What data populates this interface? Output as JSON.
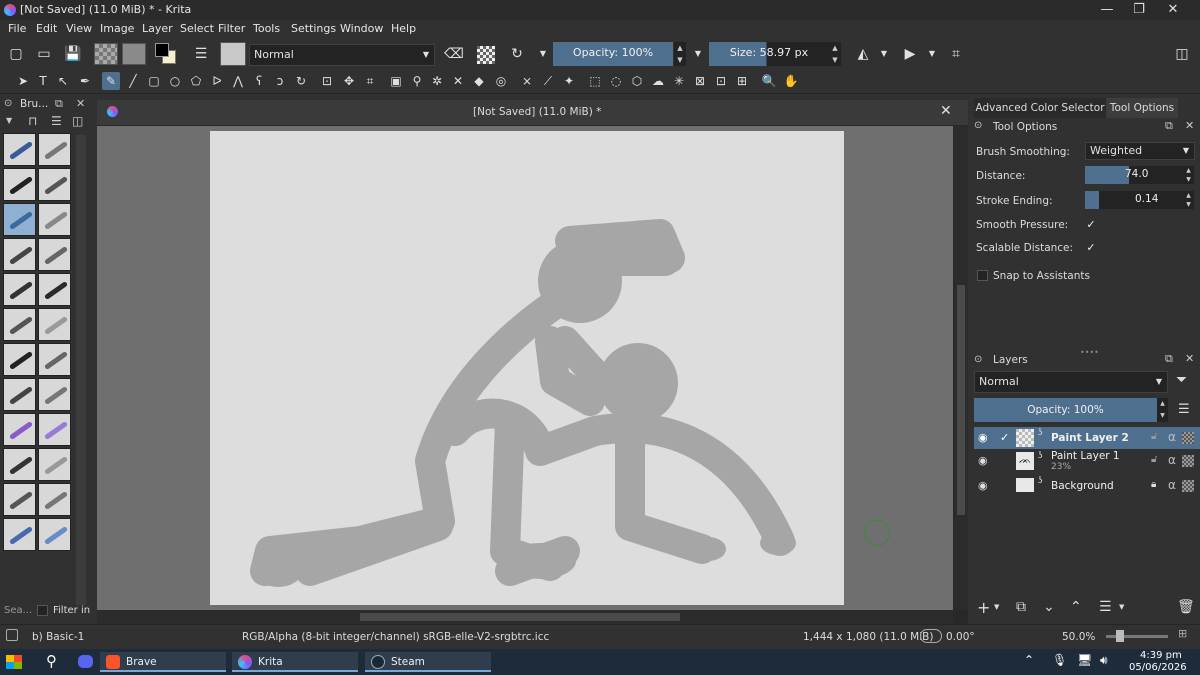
{
  "window": {
    "title": "[Not Saved]  (11.0 MiB) * - Krita",
    "minimize": "—",
    "restore": "❐",
    "close": "✕"
  },
  "menu": [
    "File",
    "Edit",
    "View",
    "Image",
    "Layer",
    "Select",
    "Filter",
    "Tools",
    "Settings",
    "Window",
    "Help"
  ],
  "toolbar": {
    "blend_mode": "Normal",
    "opacity_label": "Opacity: 100%",
    "size_label": "Size: 58.97 px"
  },
  "brush_panel": {
    "title": "Bru...",
    "search_placeholder": "Sea...",
    "filter_label": "Filter in"
  },
  "document": {
    "tab_title": "[Not Saved]  (11.0 MiB) *"
  },
  "right_panel": {
    "tabs": [
      "Advanced Color Selector",
      "Tool Options"
    ],
    "tool_options_title": "Tool Options",
    "brush_smoothing_label": "Brush Smoothing:",
    "brush_smoothing_value": "Weighted",
    "distance_label": "Distance:",
    "distance_value": "74.0",
    "distance_fill": 0.45,
    "stroke_ending_label": "Stroke Ending:",
    "stroke_ending_value": "0.14",
    "stroke_ending_fill": 0.14,
    "smooth_pressure_label": "Smooth Pressure:",
    "scalable_distance_label": "Scalable Distance:",
    "snap_label": "Snap to Assistants"
  },
  "layers": {
    "title": "Layers",
    "blend_mode": "Normal",
    "opacity_label": "Opacity:  100%",
    "items": [
      {
        "name": "Paint Layer 2",
        "sub": "",
        "active": true
      },
      {
        "name": "Paint Layer 1",
        "sub": "23%",
        "active": false
      },
      {
        "name": "Background",
        "sub": "",
        "active": false
      }
    ]
  },
  "status": {
    "brush": "b) Basic-1",
    "color_model": "RGB/Alpha (8-bit integer/channel)  sRGB-elle-V2-srgbtrc.icc",
    "dimensions": "1,444 x 1,080 (11.0 MiB)",
    "rotation": "0.00°",
    "zoom": "50.0%"
  },
  "taskbar": {
    "apps": [
      "Brave",
      "Krita",
      "Steam"
    ],
    "time": "4:39 pm",
    "date": "05/06/2026"
  },
  "colors": {
    "accent": "#4f6f8f",
    "stroke": "#a6a6a6",
    "paper": "#dddddd"
  }
}
